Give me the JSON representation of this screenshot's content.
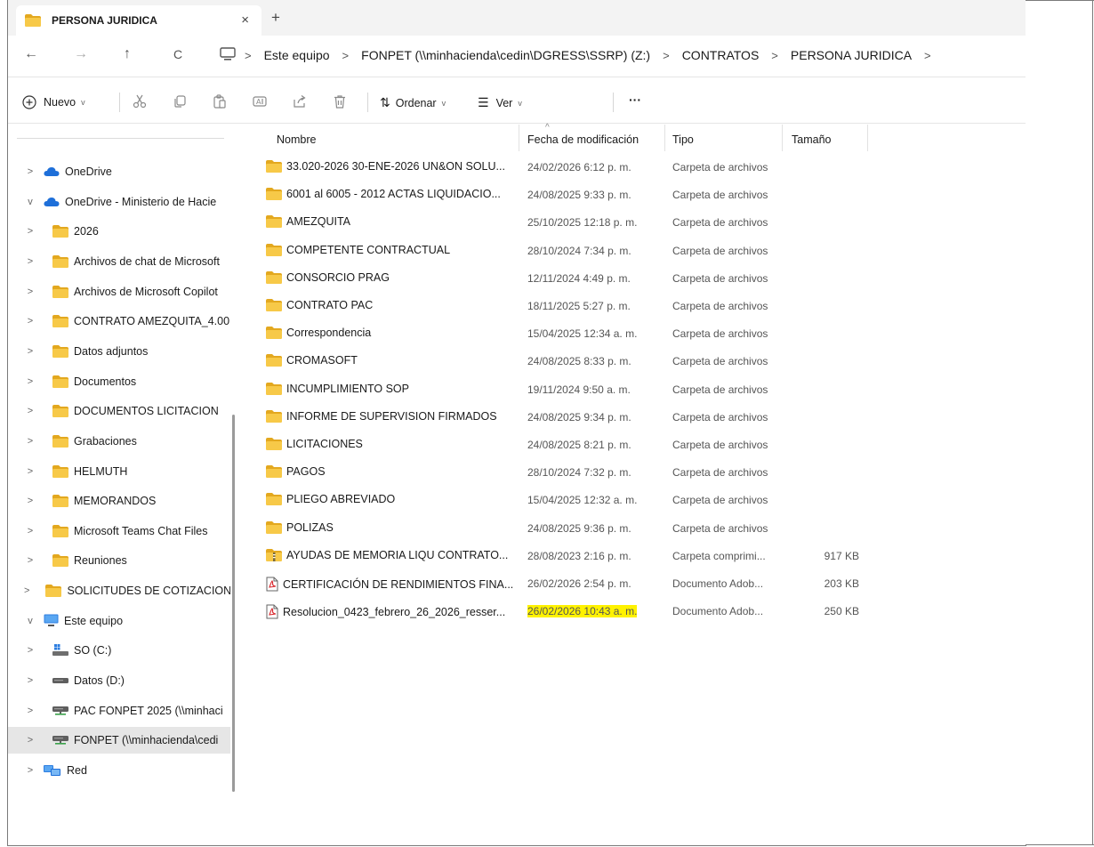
{
  "window": {
    "tab_title": "PERSONA JURIDICA",
    "tab_close": "×",
    "new_tab": "+"
  },
  "nav": {
    "back": "←",
    "forward": "→",
    "up": "↑",
    "refresh": "C"
  },
  "breadcrumbs": [
    "Este equipo",
    "FONPET (\\\\minhacienda\\cedin\\DGRESS\\SSRP) (Z:)",
    "CONTRATOS",
    "PERSONA JURIDICA"
  ],
  "toolbar": {
    "new_label": "Nuevo",
    "sort_label": "Ordenar",
    "view_label": "Ver",
    "more_label": "···"
  },
  "sidebar": {
    "items": [
      {
        "label": "OneDrive",
        "chevron": ">",
        "icon": "cloud-icon",
        "indent": 0
      },
      {
        "label": "OneDrive - Ministerio de Hacie",
        "chevron": "v",
        "icon": "cloud-icon",
        "indent": 0
      },
      {
        "label": "2026",
        "chevron": ">",
        "icon": "folder-icon",
        "indent": 1
      },
      {
        "label": "Archivos de chat de Microsoft",
        "chevron": ">",
        "icon": "folder-icon",
        "indent": 1
      },
      {
        "label": "Archivos de Microsoft Copilot",
        "chevron": ">",
        "icon": "folder-icon",
        "indent": 1
      },
      {
        "label": "CONTRATO AMEZQUITA_4.00",
        "chevron": ">",
        "icon": "folder-icon",
        "indent": 1
      },
      {
        "label": "Datos adjuntos",
        "chevron": ">",
        "icon": "folder-icon",
        "indent": 1
      },
      {
        "label": "Documentos",
        "chevron": ">",
        "icon": "folder-icon",
        "indent": 1
      },
      {
        "label": "DOCUMENTOS LICITACION",
        "chevron": ">",
        "icon": "folder-icon",
        "indent": 1
      },
      {
        "label": "Grabaciones",
        "chevron": ">",
        "icon": "folder-icon",
        "indent": 1
      },
      {
        "label": "HELMUTH",
        "chevron": ">",
        "icon": "folder-icon",
        "indent": 1
      },
      {
        "label": "MEMORANDOS",
        "chevron": ">",
        "icon": "folder-icon",
        "indent": 1
      },
      {
        "label": "Microsoft Teams Chat Files",
        "chevron": ">",
        "icon": "folder-icon",
        "indent": 1
      },
      {
        "label": "Reuniones",
        "chevron": ">",
        "icon": "folder-icon",
        "indent": 1
      },
      {
        "label": "SOLICITUDES DE COTIZACION",
        "chevron": ">",
        "icon": "folder-icon",
        "indent": 1
      },
      {
        "label": "Este equipo",
        "chevron": "v",
        "icon": "pc-icon",
        "indent": 0
      },
      {
        "label": "SO (C:)",
        "chevron": ">",
        "icon": "windows-drive-icon",
        "indent": 1
      },
      {
        "label": "Datos (D:)",
        "chevron": ">",
        "icon": "drive-icon",
        "indent": 1
      },
      {
        "label": "PAC FONPET 2025 (\\\\minhaci",
        "chevron": ">",
        "icon": "network-drive-icon",
        "indent": 1
      },
      {
        "label": "FONPET (\\\\minhacienda\\cedi",
        "chevron": ">",
        "icon": "network-drive-icon",
        "indent": 1,
        "selected": true
      },
      {
        "label": "Red",
        "chevron": ">",
        "icon": "network-icon",
        "indent": 0
      }
    ]
  },
  "columns": {
    "name": "Nombre",
    "date": "Fecha de modificación",
    "type": "Tipo",
    "size": "Tamaño"
  },
  "files": [
    {
      "name": "33.020-2026 30-ENE-2026 UN&ON SOLU...",
      "date": "24/02/2026 6:12 p. m.",
      "type": "Carpeta de archivos",
      "size": "",
      "icon": "folder-icon"
    },
    {
      "name": "6001 al 6005 - 2012 ACTAS LIQUIDACIO...",
      "date": "24/08/2025 9:33 p. m.",
      "type": "Carpeta de archivos",
      "size": "",
      "icon": "folder-icon"
    },
    {
      "name": "AMEZQUITA",
      "date": "25/10/2025 12:18 p. m.",
      "type": "Carpeta de archivos",
      "size": "",
      "icon": "folder-icon"
    },
    {
      "name": "COMPETENTE CONTRACTUAL",
      "date": "28/10/2024 7:34 p. m.",
      "type": "Carpeta de archivos",
      "size": "",
      "icon": "folder-icon"
    },
    {
      "name": "CONSORCIO PRAG",
      "date": "12/11/2024 4:49 p. m.",
      "type": "Carpeta de archivos",
      "size": "",
      "icon": "folder-icon"
    },
    {
      "name": "CONTRATO PAC",
      "date": "18/11/2025 5:27 p. m.",
      "type": "Carpeta de archivos",
      "size": "",
      "icon": "folder-icon"
    },
    {
      "name": "Correspondencia",
      "date": "15/04/2025 12:34 a. m.",
      "type": "Carpeta de archivos",
      "size": "",
      "icon": "folder-icon"
    },
    {
      "name": "CROMASOFT",
      "date": "24/08/2025 8:33 p. m.",
      "type": "Carpeta de archivos",
      "size": "",
      "icon": "folder-icon"
    },
    {
      "name": "INCUMPLIMIENTO SOP",
      "date": "19/11/2024 9:50 a. m.",
      "type": "Carpeta de archivos",
      "size": "",
      "icon": "folder-icon"
    },
    {
      "name": "INFORME DE SUPERVISION FIRMADOS",
      "date": "24/08/2025 9:34 p. m.",
      "type": "Carpeta de archivos",
      "size": "",
      "icon": "folder-icon"
    },
    {
      "name": "LICITACIONES",
      "date": "24/08/2025 8:21 p. m.",
      "type": "Carpeta de archivos",
      "size": "",
      "icon": "folder-icon"
    },
    {
      "name": "PAGOS",
      "date": "28/10/2024 7:32 p. m.",
      "type": "Carpeta de archivos",
      "size": "",
      "icon": "folder-icon"
    },
    {
      "name": "PLIEGO ABREVIADO",
      "date": "15/04/2025 12:32 a. m.",
      "type": "Carpeta de archivos",
      "size": "",
      "icon": "folder-icon"
    },
    {
      "name": "POLIZAS",
      "date": "24/08/2025 9:36 p. m.",
      "type": "Carpeta de archivos",
      "size": "",
      "icon": "folder-icon"
    },
    {
      "name": "AYUDAS DE MEMORIA LIQU CONTRATO...",
      "date": "28/08/2023 2:16 p. m.",
      "type": "Carpeta comprimi...",
      "size": "917 KB",
      "icon": "zip-folder-icon"
    },
    {
      "name": "CERTIFICACIÓN DE RENDIMIENTOS FINA...",
      "date": "26/02/2026 2:54 p. m.",
      "type": "Documento Adob...",
      "size": "203 KB",
      "icon": "pdf-icon"
    },
    {
      "name": "Resolucion_0423_febrero_26_2026_resser...",
      "date": "26/02/2026 10:43 a. m.",
      "type": "Documento Adob...",
      "size": "250 KB",
      "icon": "pdf-icon",
      "date_highlighted": true
    }
  ],
  "colors": {
    "folder": "#f7c948",
    "folder_dark": "#e3a81f",
    "cloud": "#1e6fd9",
    "highlight": "#fff200",
    "pdf_red": "#d8252b"
  }
}
